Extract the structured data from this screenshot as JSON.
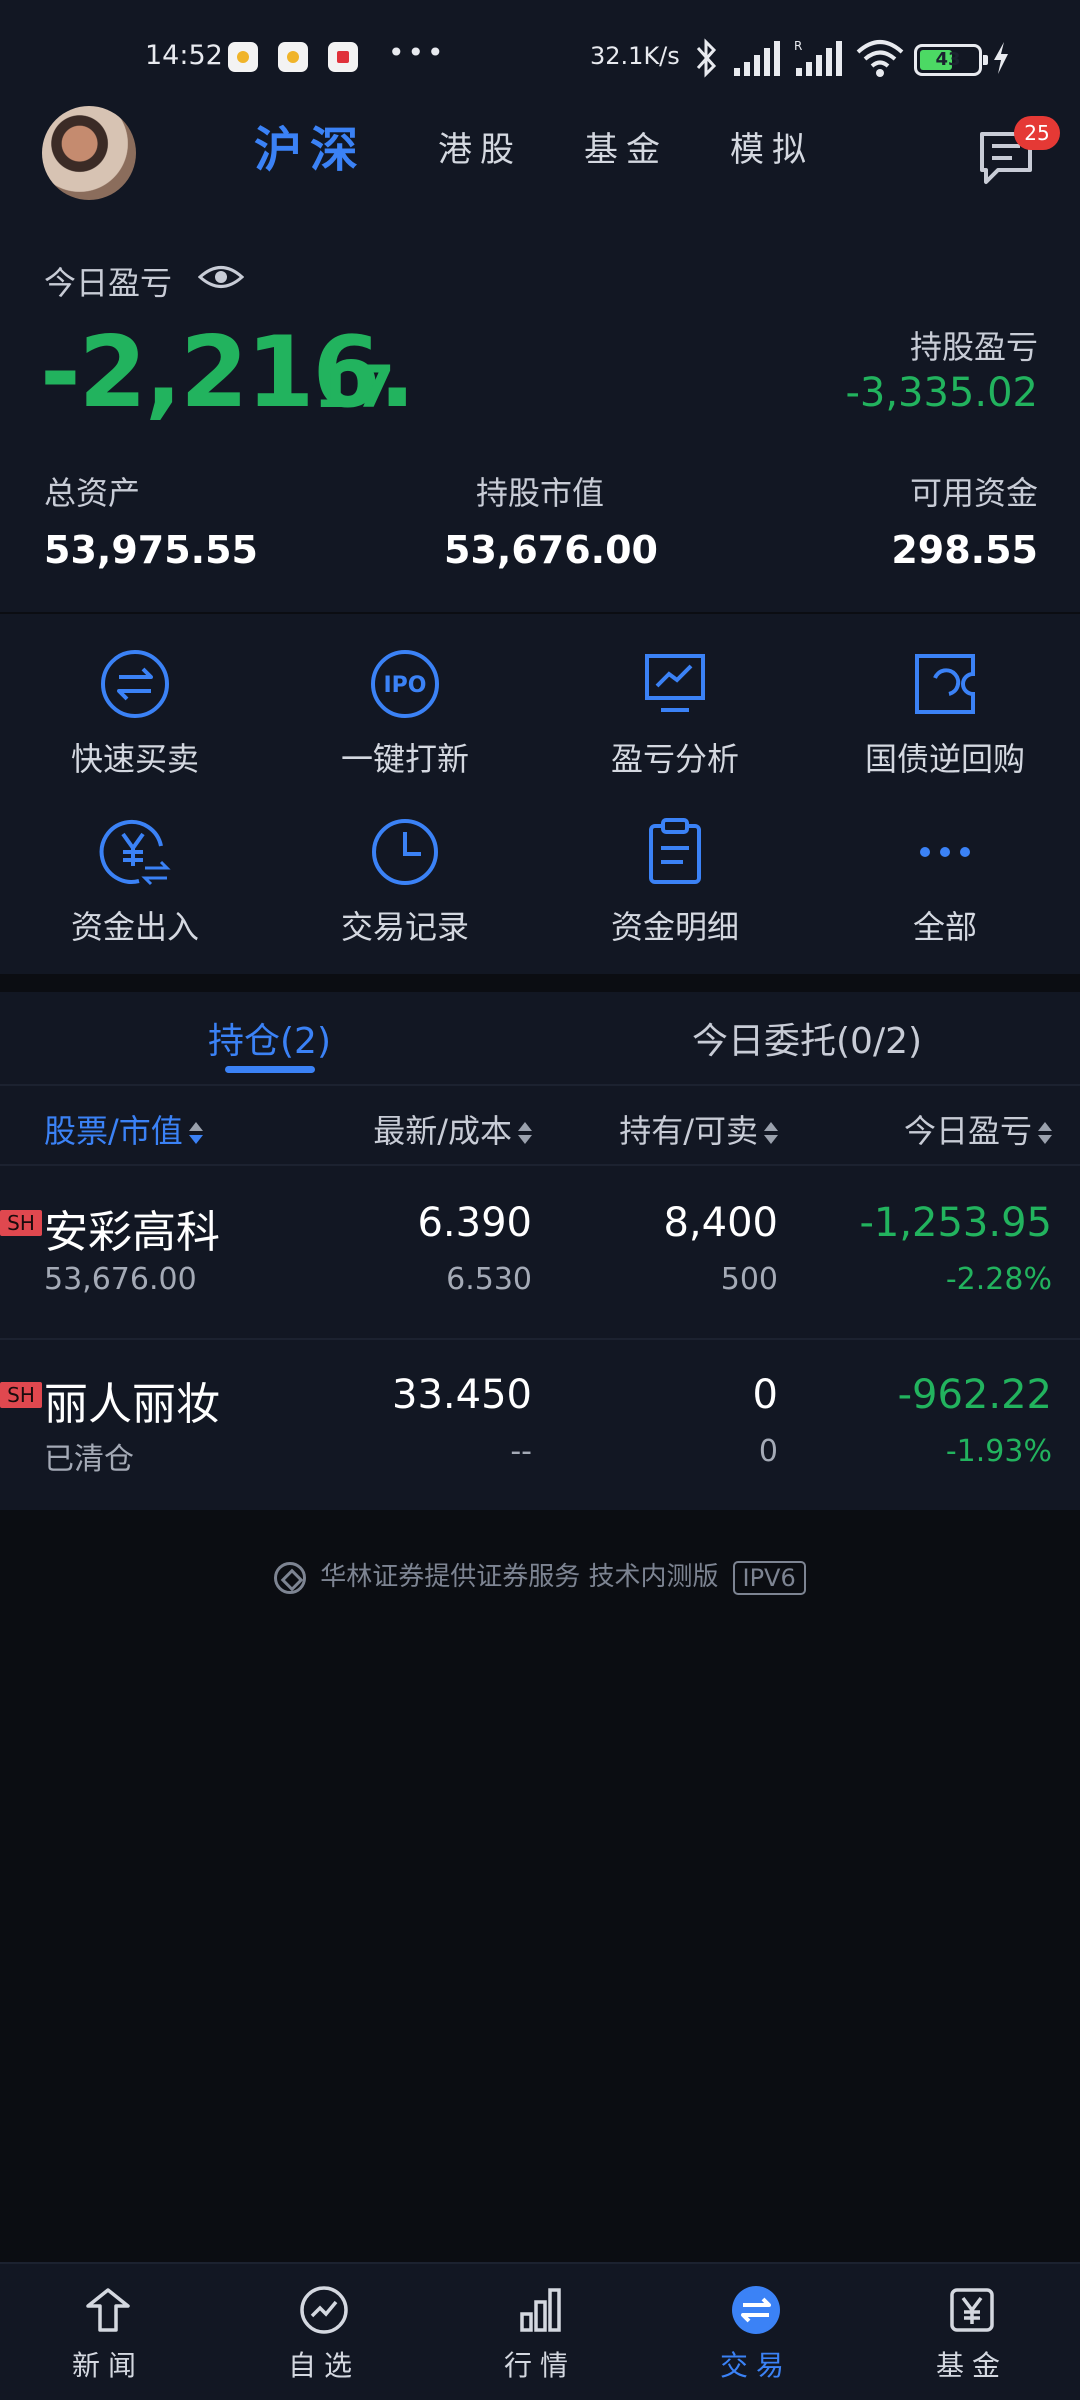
{
  "status_bar": {
    "time": "14:52",
    "more": "•••",
    "net_speed": "32.1K/s",
    "battery": "43",
    "icons": [
      "bluetooth-icon",
      "signal-icon",
      "signal-r-icon",
      "wifi-icon",
      "charging-icon"
    ]
  },
  "header": {
    "tabs": [
      "沪深",
      "港股",
      "基金",
      "模拟"
    ],
    "active_tab": "沪深",
    "message_count": "25"
  },
  "summary": {
    "today_pl_label": "今日盈亏",
    "today_pl_int": "-2,216.",
    "today_pl_dec": "17",
    "holding_pl_label": "持股盈亏",
    "holding_pl": "-3,335.02",
    "total_assets_label": "总资产",
    "total_assets": "53,975.55",
    "market_value_label": "持股市值",
    "market_value": "53,676.00",
    "available_label": "可用资金",
    "available": "298.55"
  },
  "shortcuts": [
    {
      "label": "快速买卖",
      "icon": "swap-icon"
    },
    {
      "label": "一键打新",
      "icon": "ipo-icon"
    },
    {
      "label": "盈亏分析",
      "icon": "chart-icon"
    },
    {
      "label": "国债逆回购",
      "icon": "repo-icon"
    },
    {
      "label": "资金出入",
      "icon": "yuan-transfer-icon"
    },
    {
      "label": "交易记录",
      "icon": "clock-icon"
    },
    {
      "label": "资金明细",
      "icon": "clipboard-icon"
    },
    {
      "label": "全部",
      "icon": "more-dots-icon"
    }
  ],
  "holdings": {
    "tab_positions": "持仓(2)",
    "tab_orders": "今日委托(0/2)",
    "columns": [
      "股票/市值",
      "最新/成本",
      "持有/可卖",
      "今日盈亏"
    ],
    "rows": [
      {
        "tag": "SH",
        "name": "安彩高科",
        "sub": "53,676.00",
        "price": "6.390",
        "cost": "6.530",
        "hold": "8,400",
        "sellable": "500",
        "pl": "-1,253.95",
        "pl_pct": "-2.28%"
      },
      {
        "tag": "SH",
        "name": "丽人丽妆",
        "sub": "已清仓",
        "price": "33.450",
        "cost": "--",
        "hold": "0",
        "sellable": "0",
        "pl": "-962.22",
        "pl_pct": "-1.93%"
      }
    ]
  },
  "footer": {
    "text": "华林证券提供证券服务 技术内测版",
    "badge": "IPV6"
  },
  "bottom_nav": [
    {
      "label": "新闻",
      "icon": "news-icon"
    },
    {
      "label": "自选",
      "icon": "watchlist-icon"
    },
    {
      "label": "行情",
      "icon": "market-icon"
    },
    {
      "label": "交易",
      "icon": "trade-icon",
      "active": true
    },
    {
      "label": "基金",
      "icon": "fund-icon"
    }
  ],
  "colors": {
    "accent": "#3b82f6",
    "loss_green": "#22b35e",
    "background": "#0b0d12",
    "panel": "#121723"
  }
}
